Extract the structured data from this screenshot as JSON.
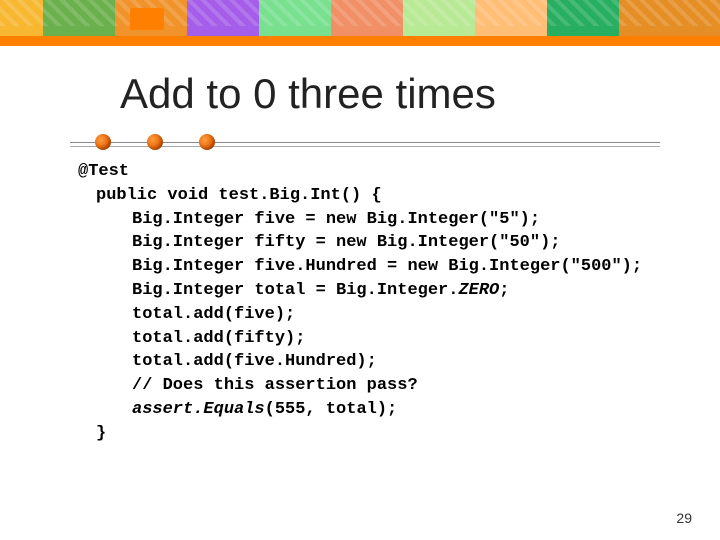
{
  "title": "Add to 0 three times",
  "code": {
    "l0": "@Test",
    "l1": "public void test.Big.Int() {",
    "l2": "Big.Integer five = new Big.Integer(\"5\");",
    "l3": "Big.Integer fifty = new Big.Integer(\"50\");",
    "l4": "Big.Integer five.Hundred = new Big.Integer(\"500\");",
    "l5_a": "Big.Integer total = Big.Integer.",
    "l5_zero": "ZERO",
    "l5_b": ";",
    "l6": "total.add(five);",
    "l7": "total.add(fifty);",
    "l8": "total.add(five.Hundred);",
    "l9": "// Does this assertion pass?",
    "l10_a": "assert.Equals",
    "l10_b": "(555, total);",
    "l11": "}"
  },
  "page_number": "29"
}
